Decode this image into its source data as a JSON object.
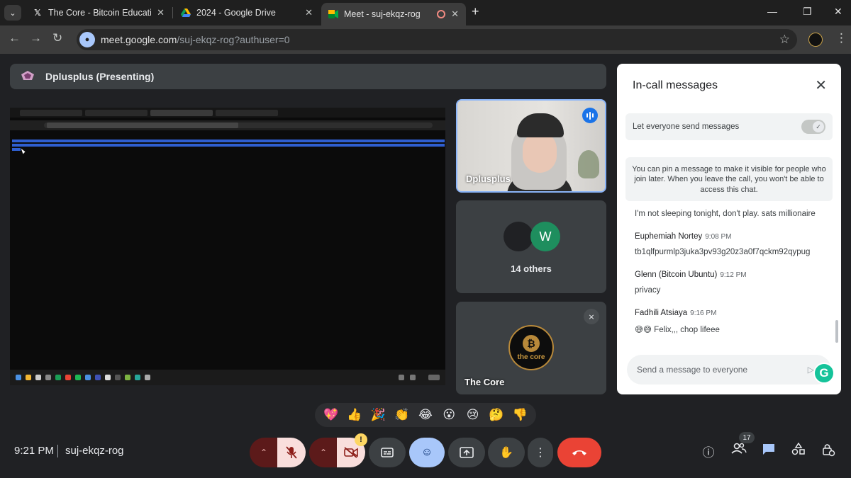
{
  "browser": {
    "tabs": [
      {
        "title": "The Core - Bitcoin Education (@",
        "icon": "x-logo-icon"
      },
      {
        "title": "2024 - Google Drive",
        "icon": "google-drive-icon"
      },
      {
        "title": "Meet - suj-ekqz-rog",
        "icon": "google-meet-icon",
        "active": true
      }
    ],
    "url_host": "meet.google.com",
    "url_path": "/suj-ekqz-rog?authuser=0"
  },
  "presentation": {
    "presenter_label": "Dplusplus (Presenting)"
  },
  "tiles": {
    "self_name": "Dplusplus",
    "others_label": "14 others",
    "others_avatar_letter": "W",
    "core_name": "The Core",
    "core_logo_text": "the core",
    "core_logo_letter": "₿"
  },
  "chat": {
    "title": "In-call messages",
    "permission_label": "Let everyone send messages",
    "pin_info": "You can pin a message to make it visible for people who join later. When you leave the call, you won't be able to access this chat.",
    "messages": [
      {
        "sender": "",
        "time": "",
        "text": "I'm not sleeping tonight, don't play. sats millionaire"
      },
      {
        "sender": "Euphemiah Nortey",
        "time": "9:08 PM",
        "text": "tb1qlfpurmlp3juka3pv93g20z3a0f7qckm92qypug"
      },
      {
        "sender": "Glenn (Bitcoin Ubuntu)",
        "time": "9:12 PM",
        "text": "privacy"
      },
      {
        "sender": "Fadhili Atsiaya",
        "time": "9:16 PM",
        "text": "😅😅 Felix,,, chop lifeee"
      }
    ],
    "input_placeholder": "Send a message to everyone",
    "grammarly_letter": "G"
  },
  "reactions": [
    "💖",
    "👍",
    "🎉",
    "👏",
    "😂",
    "😮",
    "😢",
    "🤔",
    "👎"
  ],
  "controls": {
    "time": "9:21 PM",
    "meeting_code": "suj-ekqz-rog",
    "warning_badge": "!",
    "people_count": "17"
  },
  "colors": {
    "accent": "#8ab4f8",
    "hangup": "#ea4335",
    "mic_off_bg": "#f9dedc",
    "blue_button": "#a8c7fa"
  }
}
